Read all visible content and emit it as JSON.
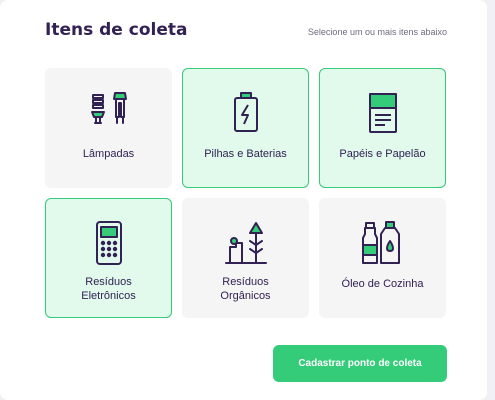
{
  "section": {
    "title": "Itens de coleta",
    "subtitle": "Selecione um ou mais itens abaixo"
  },
  "items": [
    {
      "label": "Lâmpadas",
      "icon": "lamp-icon",
      "selected": false
    },
    {
      "label": "Pilhas e Baterias",
      "icon": "battery-icon",
      "selected": true
    },
    {
      "label": "Papéis e Papelão",
      "icon": "paper-icon",
      "selected": true
    },
    {
      "label": "Resíduos\nEletrônicos",
      "icon": "electronics-icon",
      "selected": true
    },
    {
      "label": "Resíduos\nOrgânicos",
      "icon": "organic-icon",
      "selected": false
    },
    {
      "label": "Óleo de Cozinha",
      "icon": "oil-icon",
      "selected": false
    }
  ],
  "actions": {
    "submit_label": "Cadastrar ponto de coleta"
  },
  "colors": {
    "title": "#322153",
    "accent": "#34cb79",
    "selected_bg": "#e1faec",
    "item_bg": "#f5f5f5"
  }
}
